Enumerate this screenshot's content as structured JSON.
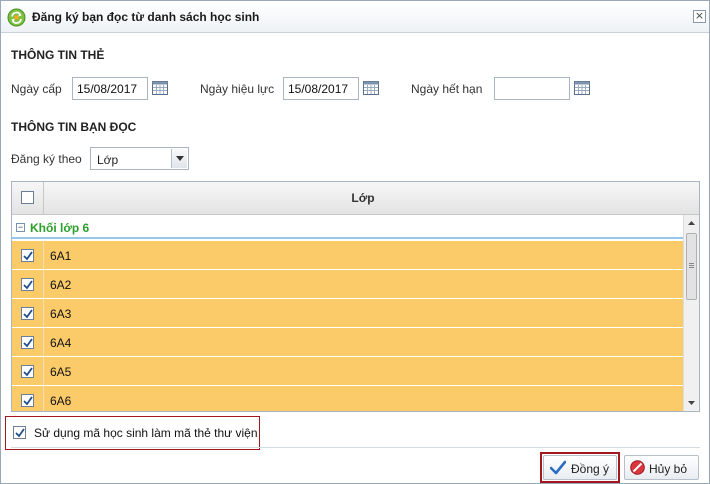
{
  "window": {
    "title": "Đăng ký bạn đọc từ danh sách học sinh",
    "close_glyph": "×"
  },
  "card_info": {
    "section_title": "THÔNG TIN THẺ",
    "issue_date_label": "Ngày cấp",
    "issue_date_value": "15/08/2017",
    "effective_date_label": "Ngày hiệu lực",
    "effective_date_value": "15/08/2017",
    "expiry_date_label": "Ngày hết hạn",
    "expiry_date_value": ""
  },
  "reader_info": {
    "section_title": "THÔNG TIN BẠN ĐỌC",
    "register_by_label": "Đăng ký theo",
    "register_by_value": "Lớp"
  },
  "grid": {
    "column_header": "Lớp",
    "group": {
      "toggle_glyph": "−",
      "label": "Khối lớp 6"
    },
    "rows": [
      {
        "name": "6A1",
        "checked": true
      },
      {
        "name": "6A2",
        "checked": true
      },
      {
        "name": "6A3",
        "checked": true
      },
      {
        "name": "6A4",
        "checked": true
      },
      {
        "name": "6A5",
        "checked": true
      },
      {
        "name": "6A6",
        "checked": true
      }
    ],
    "row_highlight_color": "#fbcb6a",
    "group_label_color": "#2ca02c"
  },
  "options": {
    "use_student_code_label": "Sử dụng mã học sinh làm mã thẻ thư viện",
    "use_student_code_checked": true
  },
  "buttons": {
    "ok_label": "Đồng ý",
    "cancel_label": "Hủy bỏ"
  },
  "icons": {
    "app": "refresh-green-icon",
    "calendar": "calendar-icon",
    "ok": "checkmark-icon",
    "cancel": "no-entry-icon"
  }
}
